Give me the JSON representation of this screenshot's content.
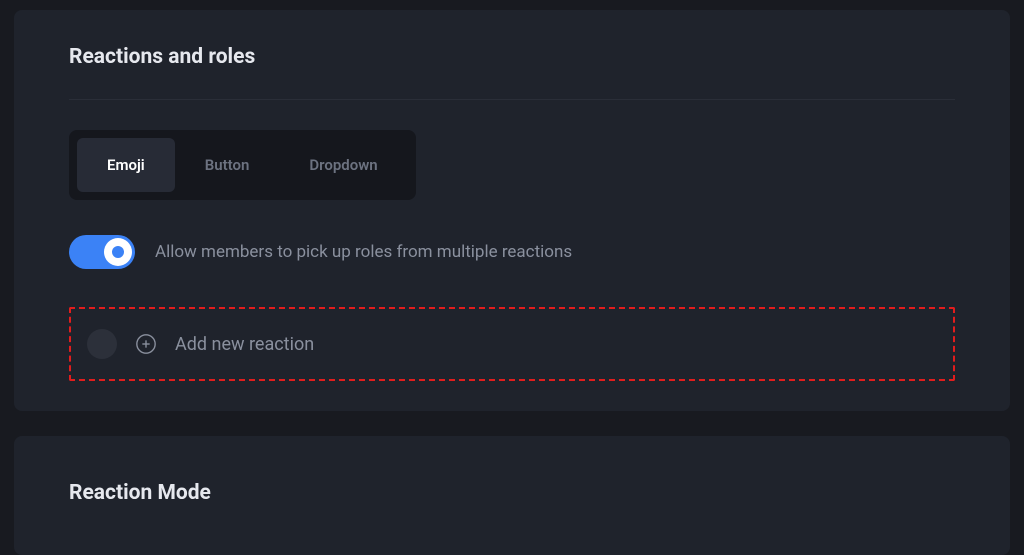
{
  "section1": {
    "title": "Reactions and roles",
    "tabs": [
      {
        "label": "Emoji",
        "active": true
      },
      {
        "label": "Button",
        "active": false
      },
      {
        "label": "Dropdown",
        "active": false
      }
    ],
    "toggle": {
      "on": true,
      "label": "Allow members to pick up roles from multiple reactions"
    },
    "add_reaction": {
      "label": "Add new reaction"
    }
  },
  "section2": {
    "title": "Reaction Mode"
  }
}
